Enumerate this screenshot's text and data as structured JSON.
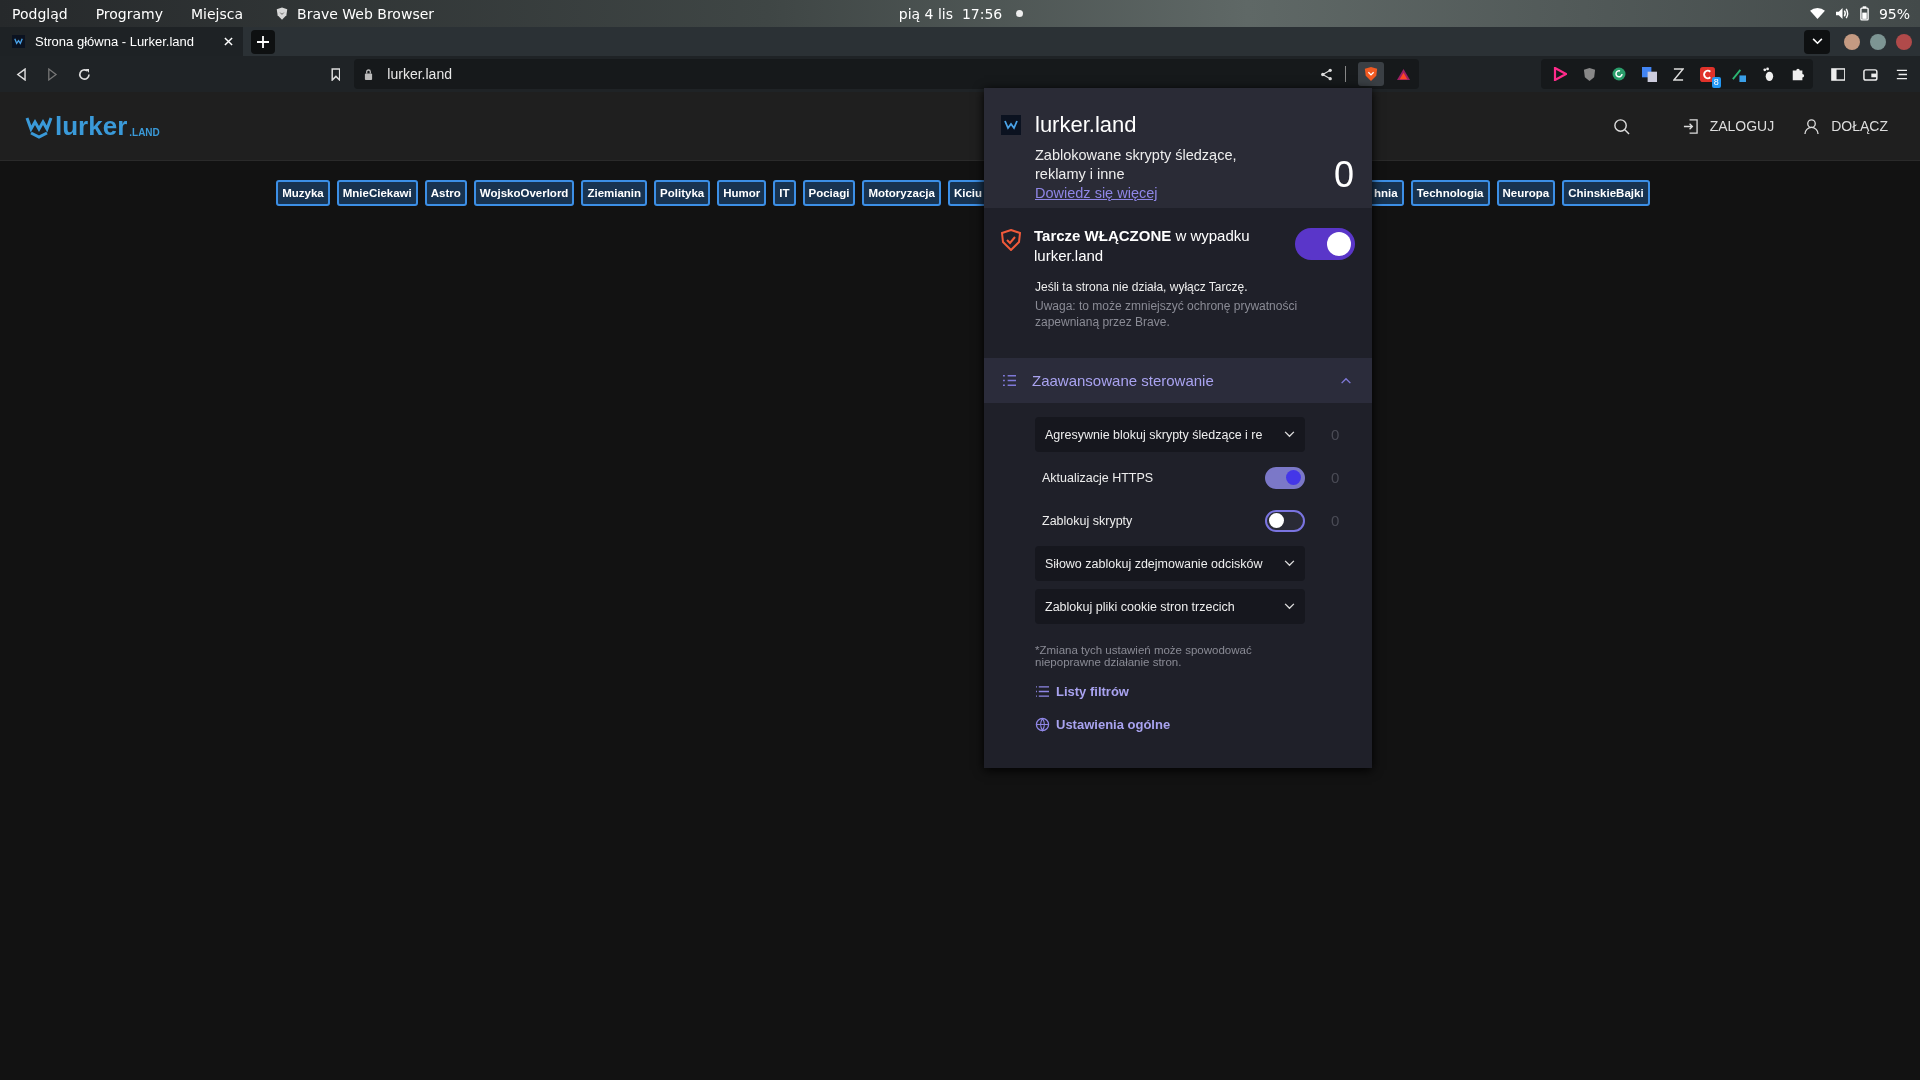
{
  "os_bar": {
    "menus": [
      "Podgląd",
      "Programy",
      "Miejsca"
    ],
    "app": "Brave Web Browser",
    "date": "pią 4 lis",
    "time": "17:56",
    "battery": "95%"
  },
  "tabs": [
    {
      "title": "Strona główna - Lurker.land",
      "selected": true
    }
  ],
  "address_bar": {
    "url": "lurker.land",
    "extension_badge": "8"
  },
  "site": {
    "logo": "lurker",
    "logo_suffix": ".LAND",
    "login": "ZALOGUJ",
    "join": "DOŁĄCZ",
    "tags_left": [
      "Muzyka",
      "MnieCiekawi",
      "Astro",
      "WojskoOverlord",
      "Ziemianin",
      "Polityka",
      "Humor",
      "IT",
      "Pociagi",
      "Motoryzacja",
      "Kiciu"
    ],
    "tags_right": [
      "hnia",
      "Technologia",
      "Neuropa",
      "ChinskieBajki"
    ]
  },
  "popup": {
    "site": "lurker.land",
    "blocked_text": "Zablokowane skrypty śledzące, reklamy i inne",
    "learn_more": "Dowiedz się więcej",
    "blocked_count": "0",
    "shields": {
      "text": "**Tarcze WŁĄCZONE** w wypadku lurker.land",
      "on": true
    },
    "hint": "Jeśli ta strona nie działa, wyłącz Tarczę.",
    "warning": "Uwaga: to może zmniejszyć ochronę prywatności zapewnianą przez Brave.",
    "advanced": {
      "title": "Zaawansowane sterowanie",
      "expanded": true,
      "controls": [
        {
          "kind": "dropdown",
          "label": "Agresywnie blokuj skrypty śledzące i re",
          "count": "0"
        },
        {
          "kind": "toggle",
          "label": "Aktualizacje HTTPS",
          "on": true,
          "count": "0"
        },
        {
          "kind": "toggle",
          "label": "Zablokuj skrypty",
          "on": false,
          "count": "0"
        },
        {
          "kind": "dropdown",
          "label": "Siłowo zablokuj zdejmowanie odcisków"
        },
        {
          "kind": "dropdown",
          "label": "Zablokuj pliki cookie stron trzecich"
        }
      ],
      "note": "*Zmiana tych ustawień może spowodować niepoprawne działanie stron.",
      "links": [
        "Listy filtrów",
        "Ustawienia ogólne"
      ]
    }
  }
}
